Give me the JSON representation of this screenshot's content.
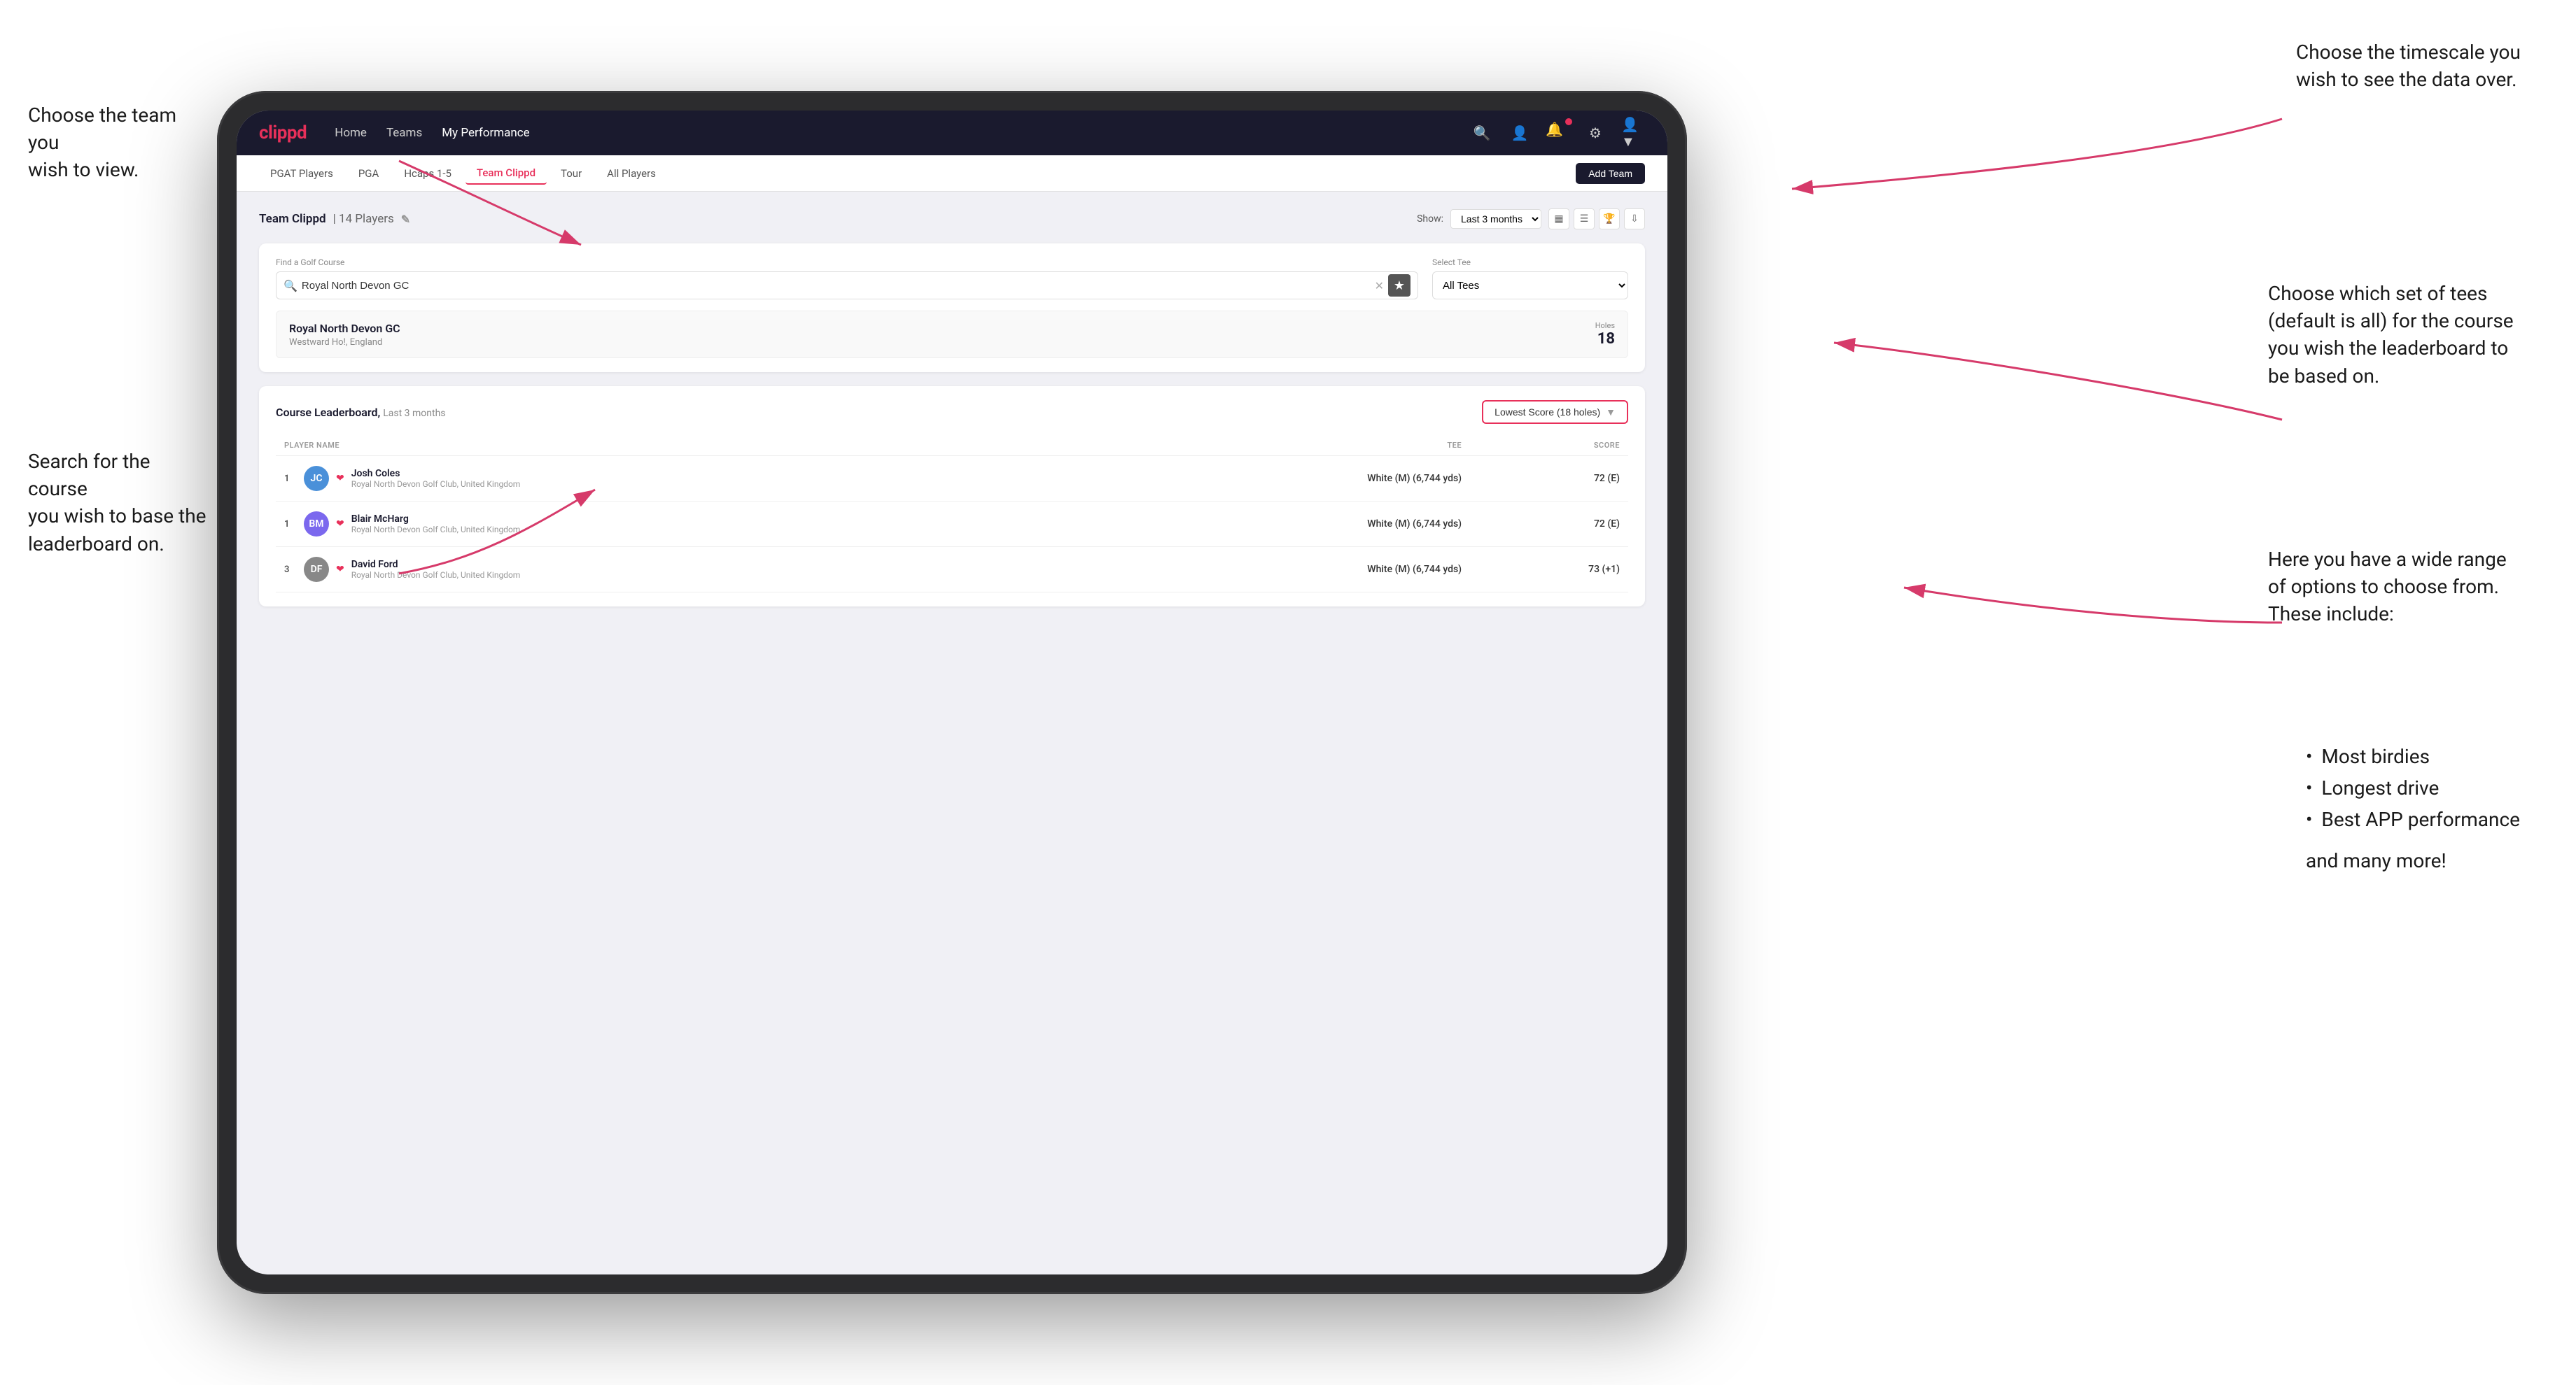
{
  "annotations": {
    "team_label": "Choose the team you\nwish to view.",
    "timescale_label": "Choose the timescale you\nwish to see the data over.",
    "tees_label": "Choose which set of tees\n(default is all) for the course\nyou wish the leaderboard to\nbe based on.",
    "search_label": "Search for the course\nyou wish to base the\nleaderboard on.",
    "options_label": "Here you have a wide range\nof options to choose from.\nThese include:",
    "options_items": [
      "Most birdies",
      "Longest drive",
      "Best APP performance"
    ],
    "and_more": "and many more!"
  },
  "nav": {
    "logo": "clippd",
    "links": [
      "Home",
      "Teams",
      "My Performance"
    ],
    "active_link": "My Performance"
  },
  "sub_nav": {
    "items": [
      "PGAT Players",
      "PGA",
      "Hcaps 1-5",
      "Team Clippd",
      "Tour",
      "All Players"
    ],
    "active_item": "Team Clippd",
    "add_team_label": "Add Team"
  },
  "team_header": {
    "title": "Team Clippd",
    "player_count": "14 Players",
    "show_label": "Show:",
    "time_period": "Last 3 months"
  },
  "search": {
    "find_label": "Find a Golf Course",
    "placeholder": "Royal North Devon GC",
    "tee_label": "Select Tee",
    "tee_value": "All Tees"
  },
  "course": {
    "name": "Royal North Devon GC",
    "location": "Westward Ho!, England",
    "holes_label": "Holes",
    "holes_num": "18"
  },
  "leaderboard": {
    "title": "Course Leaderboard,",
    "subtitle": "Last 3 months",
    "score_type": "Lowest Score (18 holes)",
    "columns": {
      "player": "PLAYER NAME",
      "tee": "TEE",
      "score": "SCORE"
    },
    "rows": [
      {
        "rank": "1",
        "name": "Josh Coles",
        "club": "Royal North Devon Golf Club, United Kingdom",
        "tee": "White (M) (6,744 yds)",
        "score": "72 (E)",
        "initials": "JC",
        "avatar_color": "josh"
      },
      {
        "rank": "1",
        "name": "Blair McHarg",
        "club": "Royal North Devon Golf Club, United Kingdom",
        "tee": "White (M) (6,744 yds)",
        "score": "72 (E)",
        "initials": "BM",
        "avatar_color": "blair"
      },
      {
        "rank": "3",
        "name": "David Ford",
        "club": "Royal North Devon Golf Club, United Kingdom",
        "tee": "White (M) (6,744 yds)",
        "score": "73 (+1)",
        "initials": "DF",
        "avatar_color": "david"
      }
    ]
  }
}
